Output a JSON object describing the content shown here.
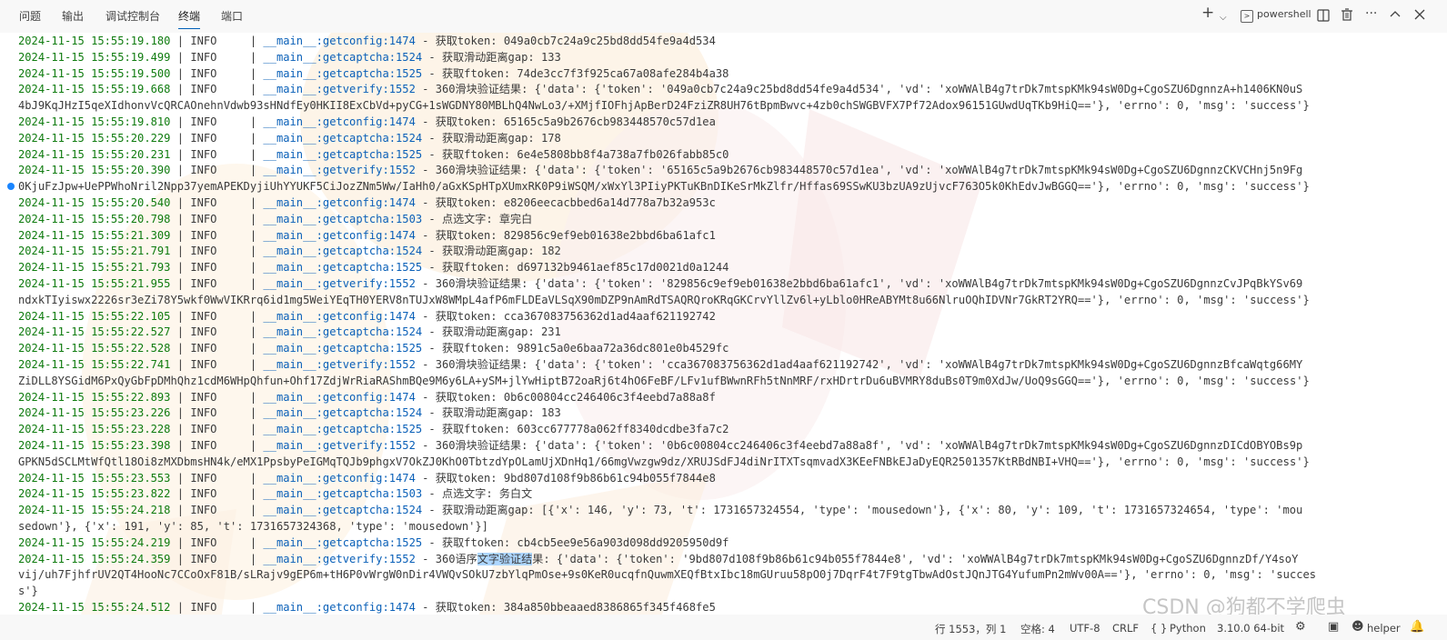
{
  "tabs": [
    "问题",
    "输出",
    "调试控制台",
    "终端",
    "端口"
  ],
  "active_tab": "终端",
  "toolbar": {
    "new_terminal": "+",
    "shell_name": "powershell"
  },
  "terminal": {
    "lines": [
      {
        "ts": "2024-11-15 15:55:19.180",
        "lvl": "INFO",
        "fn": "__main__:getconfig:1474",
        "msg": " - 获取token: 049a0cb7c24a9c25bd8dd54fe9a4d534"
      },
      {
        "ts": "2024-11-15 15:55:19.499",
        "lvl": "INFO",
        "fn": "__main__:getcaptcha:1524",
        "msg": " - 获取滑动距离gap: 133"
      },
      {
        "ts": "2024-11-15 15:55:19.500",
        "lvl": "INFO",
        "fn": "__main__:getcaptcha:1525",
        "msg": " - 获取ftoken: 74de3cc7f3f925ca67a08afe284b4a38"
      },
      {
        "ts": "2024-11-15 15:55:19.668",
        "lvl": "INFO",
        "fn": "__main__:getverify:1552",
        "msg": " - 360滑块验证结果: {'data': {'token': '049a0cb7c24a9c25bd8dd54fe9a4d534', 'vd': 'xoWWAlB4g7trDk7mtspKMk94sW0Dg+CgoSZU6DgnnzA+h1406KN0uS"
      },
      {
        "cont": "4bJ9KqJHzI5qeXIdhonvVcQRCAOnehnVdwb93sHNdfEy0HKII8ExCbVd+pyCG+1sWGDNY80MBLhQ4NwLo3/+XMjfIOFhjApBerD24FziZR8UH76tBpmBwvc+4zb0chSWGBVFX7Pf72Adox96151GUwdUqTKb9HiQ=='}, 'errno': 0, 'msg': 'success'}"
      },
      {
        "ts": "2024-11-15 15:55:19.810",
        "lvl": "INFO",
        "fn": "__main__:getconfig:1474",
        "msg": " - 获取token: 65165c5a9b2676cb983448570c57d1ea"
      },
      {
        "ts": "2024-11-15 15:55:20.229",
        "lvl": "INFO",
        "fn": "__main__:getcaptcha:1524",
        "msg": " - 获取滑动距离gap: 178"
      },
      {
        "ts": "2024-11-15 15:55:20.231",
        "lvl": "INFO",
        "fn": "__main__:getcaptcha:1525",
        "msg": " - 获取ftoken: 6e4e5808bb8f4a738a7fb026fabb85c0"
      },
      {
        "ts": "2024-11-15 15:55:20.390",
        "lvl": "INFO",
        "fn": "__main__:getverify:1552",
        "msg": " - 360滑块验证结果: {'data': {'token': '65165c5a9b2676cb983448570c57d1ea', 'vd': 'xoWWAlB4g7trDk7mtspKMk94sW0Dg+CgoSZU6DgnnzCKVCHnj5n9Fg"
      },
      {
        "cont": "0KjuFzJpw+UePPWhoNril2Npp37yemAPEKDyjiUhYYUKF5CiJozZNm5Ww/IaHh0/aGxKSpHTpXUmxRK0P9iWSQM/xWxYl3PIiyPKTuKBnDIKeSrMkZlfr/Hffas69SSwKU3bzUA9zUjvcF763O5k0KhEdvJwBGGQ=='}, 'errno': 0, 'msg': 'success'}"
      },
      {
        "ts": "2024-11-15 15:55:20.540",
        "lvl": "INFO",
        "fn": "__main__:getconfig:1474",
        "msg": " - 获取token: e8206eecacbbed6a14d778a7b32a953c"
      },
      {
        "ts": "2024-11-15 15:55:20.798",
        "lvl": "INFO",
        "fn": "__main__:getcaptcha:1503",
        "msg": " - 点选文字: 章完白"
      },
      {
        "ts": "2024-11-15 15:55:21.309",
        "lvl": "INFO",
        "fn": "__main__:getconfig:1474",
        "msg": " - 获取token: 829856c9ef9eb01638e2bbd6ba61afc1"
      },
      {
        "ts": "2024-11-15 15:55:21.791",
        "lvl": "INFO",
        "fn": "__main__:getcaptcha:1524",
        "msg": " - 获取滑动距离gap: 182"
      },
      {
        "ts": "2024-11-15 15:55:21.793",
        "lvl": "INFO",
        "fn": "__main__:getcaptcha:1525",
        "msg": " - 获取ftoken: d697132b9461aef85c17d0021d0a1244"
      },
      {
        "ts": "2024-11-15 15:55:21.955",
        "lvl": "INFO",
        "fn": "__main__:getverify:1552",
        "msg": " - 360滑块验证结果: {'data': {'token': '829856c9ef9eb01638e2bbd6ba61afc1', 'vd': 'xoWWAlB4g7trDk7mtspKMk94sW0Dg+CgoSZU6DgnnzCvJPqBkYSv69"
      },
      {
        "cont": "ndxkTIyiswx2226sr3eZi78Y5wkf0WwVIKRrq6id1mg5WeiYEqTH0YERV8nTUJxW8WMpL4afP6mFLDEaVLSqX90mDZP9nAmRdTSAQRQroKRqGKCrvYllZv6l+yLblo0HReABYMt8u66NlruOQhIDVNr7GkRT2YRQ=='}, 'errno': 0, 'msg': 'success'}"
      },
      {
        "ts": "2024-11-15 15:55:22.105",
        "lvl": "INFO",
        "fn": "__main__:getconfig:1474",
        "msg": " - 获取token: cca367083756362d1ad4aaf621192742"
      },
      {
        "ts": "2024-11-15 15:55:22.527",
        "lvl": "INFO",
        "fn": "__main__:getcaptcha:1524",
        "msg": " - 获取滑动距离gap: 231"
      },
      {
        "ts": "2024-11-15 15:55:22.528",
        "lvl": "INFO",
        "fn": "__main__:getcaptcha:1525",
        "msg": " - 获取ftoken: 9891c5a0e6baa72a36dc801e0b4529fc"
      },
      {
        "ts": "2024-11-15 15:55:22.741",
        "lvl": "INFO",
        "fn": "__main__:getverify:1552",
        "msg": " - 360滑块验证结果: {'data': {'token': 'cca367083756362d1ad4aaf621192742', 'vd': 'xoWWAlB4g7trDk7mtspKMk94sW0Dg+CgoSZU6DgnnzBfcaWqtg66MY"
      },
      {
        "cont": "ZiDLL8YSGidM6PxQyGbFpDMhQhz1cdM6WHpQhfun+Ohf17ZdjWrRiaRAShmBQe9M6y6LA+ySM+jlYwHiptB72oaRj6t4hO6FeBF/LFv1ufBWwnRFh5tNnMRF/rxHDrtrDu6uBVMRY8duBs0T9m0XdJw/UoQ9sGGQ=='}, 'errno': 0, 'msg': 'success'}"
      },
      {
        "ts": "2024-11-15 15:55:22.893",
        "lvl": "INFO",
        "fn": "__main__:getconfig:1474",
        "msg": " - 获取token: 0b6c00804cc246406c3f4eebd7a88a8f"
      },
      {
        "ts": "2024-11-15 15:55:23.226",
        "lvl": "INFO",
        "fn": "__main__:getcaptcha:1524",
        "msg": " - 获取滑动距离gap: 183"
      },
      {
        "ts": "2024-11-15 15:55:23.228",
        "lvl": "INFO",
        "fn": "__main__:getcaptcha:1525",
        "msg": " - 获取ftoken: 603cc677778a062ff8340dcdbe3fa7c2"
      },
      {
        "ts": "2024-11-15 15:55:23.398",
        "lvl": "INFO",
        "fn": "__main__:getverify:1552",
        "msg": " - 360滑块验证结果: {'data': {'token': '0b6c00804cc246406c3f4eebd7a88a8f', 'vd': 'xoWWAlB4g7trDk7mtspKMk94sW0Dg+CgoSZU6DgnnzDICdOBYOBs9p"
      },
      {
        "cont": "GPKN5dSCLMtWfQtl18Oi8zMXDbmsHN4k/eMX1PpsbyPeIGMqTQJb9phgxV7OkZJ0KhO0TbtzdYpOLamUjXDnHq1/66mgVwzgw9dz/XRUJSdFJ4diNrITXTsqmvadX3KEeFNBkEJaDyEQR2501357KtRBdNBI+VHQ=='}, 'errno': 0, 'msg': 'success'}"
      },
      {
        "ts": "2024-11-15 15:55:23.553",
        "lvl": "INFO",
        "fn": "__main__:getconfig:1474",
        "msg": " - 获取token: 9bd807d108f9b86b61c94b055f7844e8"
      },
      {
        "ts": "2024-11-15 15:55:23.822",
        "lvl": "INFO",
        "fn": "__main__:getcaptcha:1503",
        "msg": " - 点选文字: 务白文"
      },
      {
        "ts": "2024-11-15 15:55:24.218",
        "lvl": "INFO",
        "fn": "__main__:getcaptcha:1524",
        "msg": " - 获取滑动距离gap: [{'x': 146, 'y': 73, 't': 1731657324554, 'type': 'mousedown'}, {'x': 80, 'y': 109, 't': 1731657324654, 'type': 'mou"
      },
      {
        "cont": "sedown'}, {'x': 191, 'y': 85, 't': 1731657324368, 'type': 'mousedown'}]"
      },
      {
        "ts": "2024-11-15 15:55:24.219",
        "lvl": "INFO",
        "fn": "__main__:getcaptcha:1525",
        "msg": " - 获取ftoken: cb4cb5ee9e56a903d098dd9205950d9f"
      },
      {
        "ts": "2024-11-15 15:55:24.359",
        "lvl": "INFO",
        "fn": "__main__:getverify:1552",
        "msg_a": " - 360语序",
        "msg_hl": "文字验证结",
        "msg_b": "果: {'data': {'token': '9bd807d108f9b86b61c94b055f7844e8', 'vd': 'xoWWAlB4g7trDk7mtspKMk94sW0Dg+CgoSZU6DgnnzDf/Y4soY"
      },
      {
        "cont": "vij/uh7FjhfrUV2QT4HooNc7CCoOxF81B/sLRajv9gEP6m+tH6P0vWrgW0nDir4VWQvSOkU7zbYlqPmOse+9s0KeR0ucqfnQuwmXEQfBtxIbc18mGUruu58pO0j7DqrF4t7F9tgTbwAdOstJQnJTG4YufumPn2mWv00A=='}, 'errno': 0, 'msg': 'succes"
      },
      {
        "cont": "s'}"
      },
      {
        "ts": "2024-11-15 15:55:24.512",
        "lvl": "INFO",
        "fn": "__main__:getconfig:1474",
        "msg": " - 获取token: 384a850bbeaaed8386865f345f468fe5"
      }
    ]
  },
  "watermark": "CSDN @狗都不学爬虫_",
  "statusbar": {
    "position": "行 1553，列 1",
    "spaces": "空格: 4",
    "encoding": "UTF-8",
    "eol": "CRLF",
    "language_mode": "{ }",
    "language": "Python",
    "interpreter": "3.10.0 64-bit",
    "helper": "helper"
  },
  "colors": {
    "timestamp": "#107c10",
    "function": "#0a60b8",
    "text": "#3b3b3b",
    "selection": "#add6ff",
    "accent": "#005fb8"
  }
}
